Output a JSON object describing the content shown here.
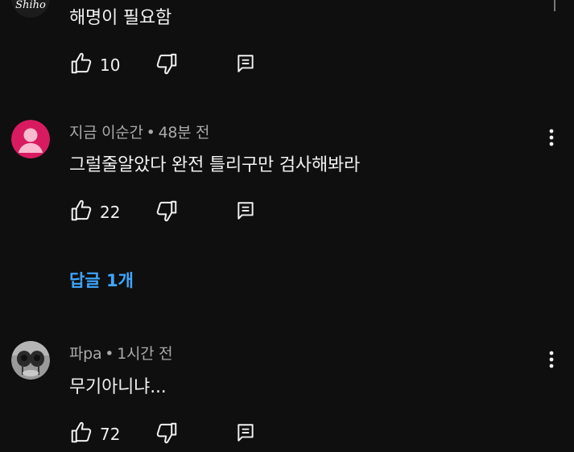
{
  "comments": [
    {
      "text": "해명이 필요함",
      "likes": "10",
      "avatar_badge": "Shiho"
    },
    {
      "author": "지금 이순간",
      "time": "48분 전",
      "text": "그럴줄알았다 완전 틀리구만 검사해봐라",
      "likes": "22",
      "avatar_color": "#d81b60"
    },
    {
      "author": "파pa",
      "time": "1시간 전",
      "text": "무기아니냐...",
      "likes": "72"
    }
  ],
  "replies_label": "답글 1개",
  "separator": "•",
  "icons": {
    "like": "thumbs-up-icon",
    "dislike": "thumbs-down-icon",
    "reply": "reply-icon",
    "more": "more-vert-icon"
  },
  "colors": {
    "background": "#0f0f0f",
    "primary_text": "#f1f1f1",
    "secondary_text": "#aaaaaa",
    "link": "#3ea6ff"
  }
}
